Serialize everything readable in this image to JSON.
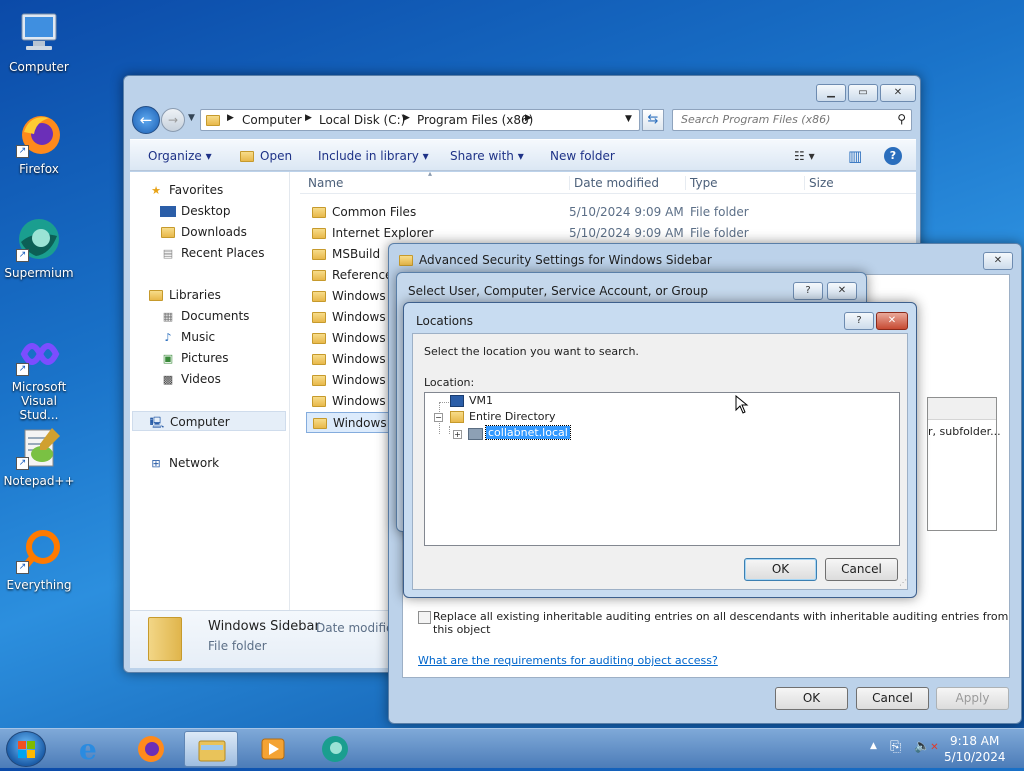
{
  "desktop": {
    "icons": [
      {
        "label": "Computer",
        "icon": "computer-icon"
      },
      {
        "label": "Firefox",
        "icon": "firefox-icon"
      },
      {
        "label": "Supermium",
        "icon": "supermium-icon"
      },
      {
        "label": "Microsoft Visual Stud...",
        "icon": "visual-studio-icon"
      },
      {
        "label": "Notepad++",
        "icon": "notepadpp-icon"
      },
      {
        "label": "Everything",
        "icon": "everything-icon"
      }
    ]
  },
  "explorer": {
    "breadcrumb": [
      "Computer",
      "Local Disk (C:)",
      "Program Files (x86)"
    ],
    "search_placeholder": "Search Program Files (x86)",
    "toolbar": {
      "organize": "Organize",
      "open": "Open",
      "include": "Include in library",
      "share": "Share with",
      "new_folder": "New folder"
    },
    "columns": {
      "name": "Name",
      "date": "Date modified",
      "type": "Type",
      "size": "Size"
    },
    "nav": {
      "favorites": "Favorites",
      "desktop": "Desktop",
      "downloads": "Downloads",
      "recent": "Recent Places",
      "libraries": "Libraries",
      "documents": "Documents",
      "music": "Music",
      "pictures": "Pictures",
      "videos": "Videos",
      "computer": "Computer",
      "network": "Network"
    },
    "files": [
      {
        "name": "Common Files",
        "date": "5/10/2024 9:09 AM",
        "type": "File folder"
      },
      {
        "name": "Internet Explorer",
        "date": "5/10/2024 9:09 AM",
        "type": "File folder"
      },
      {
        "name": "MSBuild",
        "date": "",
        "type": ""
      },
      {
        "name": "Reference A",
        "date": "",
        "type": ""
      },
      {
        "name": "Windows D",
        "date": "",
        "type": ""
      },
      {
        "name": "Windows M",
        "date": "",
        "type": ""
      },
      {
        "name": "Windows M",
        "date": "",
        "type": ""
      },
      {
        "name": "Windows N",
        "date": "",
        "type": ""
      },
      {
        "name": "Windows P",
        "date": "",
        "type": ""
      },
      {
        "name": "Windows P",
        "date": "",
        "type": ""
      },
      {
        "name": "Windows Si",
        "date": "",
        "type": ""
      }
    ],
    "details": {
      "name": "Windows Sidebar",
      "meta": "Date modified",
      "type": "File folder"
    }
  },
  "advanced": {
    "title": "Advanced Security Settings for Windows Sidebar",
    "row_text": "r, subfolder...",
    "replace_label": "Replace all existing inheritable auditing entries on all descendants with inheritable auditing entries from this object",
    "link": "What are the requirements for auditing object access?",
    "ok": "OK",
    "cancel": "Cancel",
    "apply": "Apply"
  },
  "select_user": {
    "title": "Select User, Computer, Service Account, or Group"
  },
  "locations": {
    "title": "Locations",
    "prompt": "Select the location you want to search.",
    "location_label": "Location:",
    "tree": [
      {
        "label": "VM1",
        "level": 0
      },
      {
        "label": "Entire Directory",
        "level": 0
      },
      {
        "label": "collabnet.local",
        "level": 1,
        "selected": true
      }
    ],
    "ok": "OK",
    "cancel": "Cancel"
  },
  "taskbar": {
    "time": "9:18 AM",
    "date": "5/10/2024"
  }
}
